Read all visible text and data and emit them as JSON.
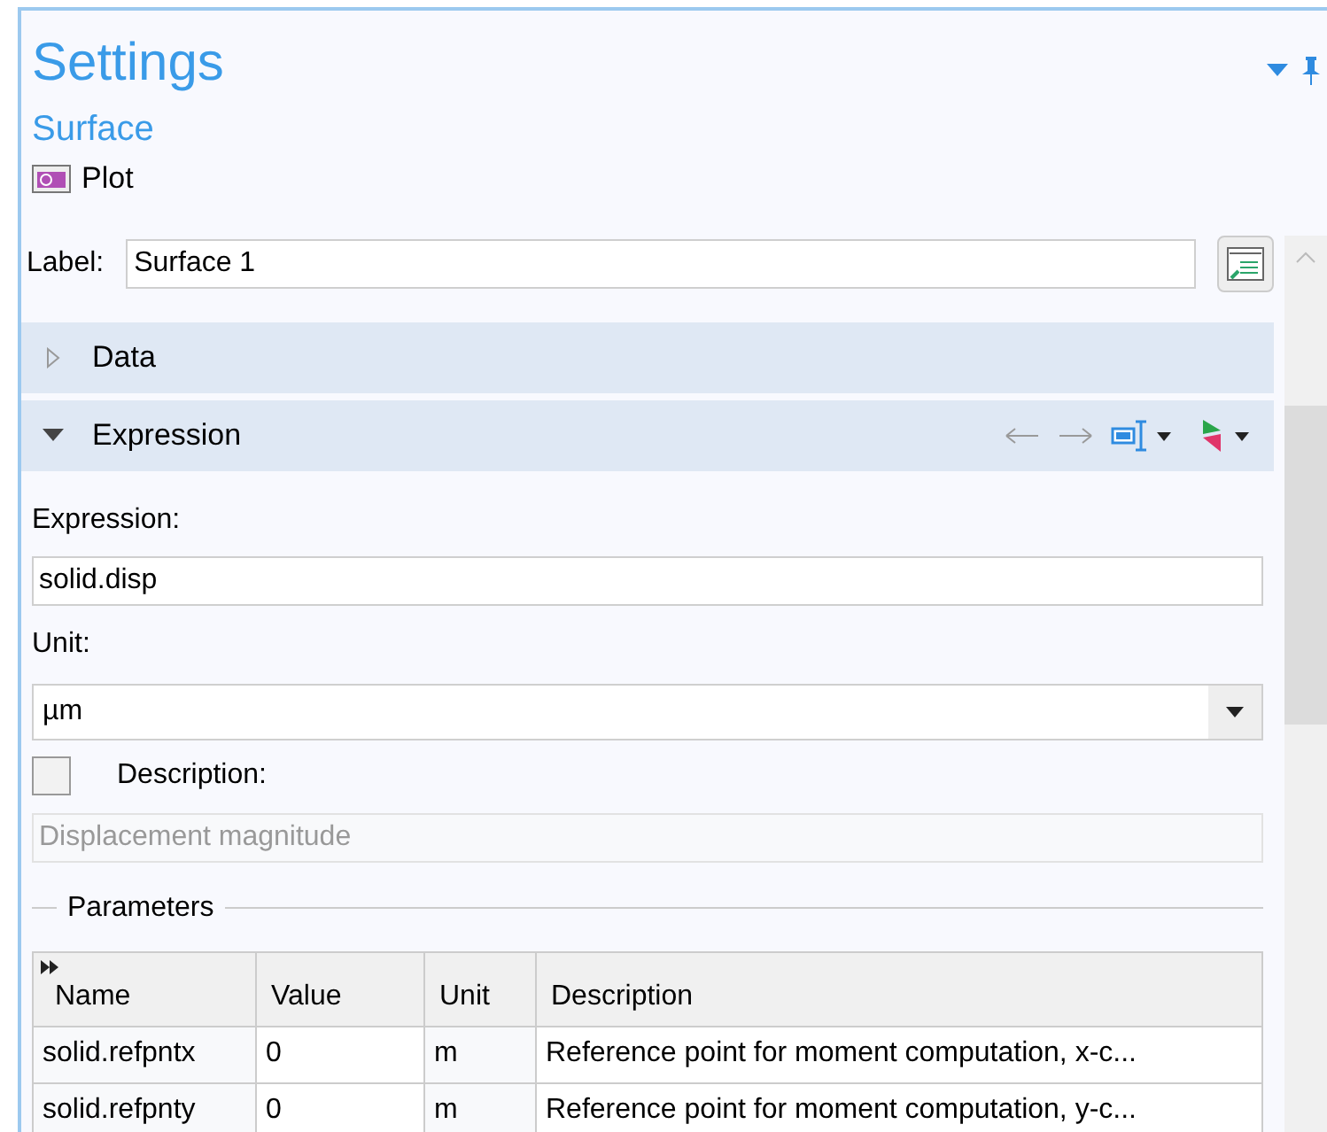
{
  "header": {
    "title": "Settings",
    "subtitle": "Surface",
    "node_type": "Plot"
  },
  "label_field": {
    "label": "Label:",
    "value": "Surface 1"
  },
  "sections": [
    {
      "title": "Data",
      "expanded": false
    },
    {
      "title": "Expression",
      "expanded": true
    }
  ],
  "expression": {
    "label": "Expression:",
    "value": "solid.disp"
  },
  "unit": {
    "label": "Unit:",
    "value": "µm"
  },
  "description": {
    "label": "Description:",
    "checked": false,
    "placeholder": "Displacement magnitude"
  },
  "parameters": {
    "title": "Parameters",
    "columns": [
      "Name",
      "Value",
      "Unit",
      "Description"
    ],
    "rows": [
      [
        "solid.refpntx",
        "0",
        "m",
        "Reference point for moment computation, x-c..."
      ],
      [
        "solid.refpnty",
        "0",
        "m",
        "Reference point for moment computation, y-c..."
      ]
    ]
  }
}
